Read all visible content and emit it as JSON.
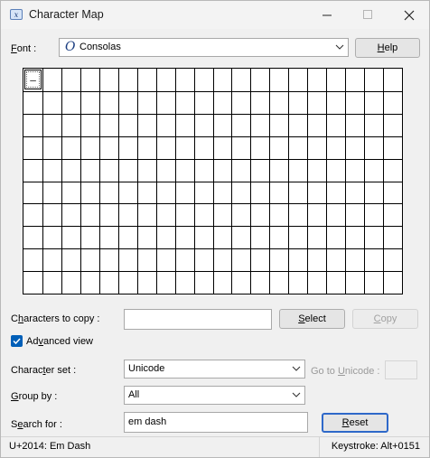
{
  "window": {
    "title": "Character Map",
    "controls": [
      "minimize",
      "maximize",
      "close"
    ]
  },
  "font": {
    "label": "Font :",
    "label_underline": "F",
    "value": "Consolas",
    "icon": "opentype-icon"
  },
  "help_button": {
    "label": "Help",
    "underline": "H"
  },
  "grid": {
    "columns": 20,
    "rows": 10,
    "selected_char": "—"
  },
  "copy": {
    "label": "Characters to copy :",
    "label_underline": "h",
    "value": "",
    "select_label": "Select",
    "select_underline": "S",
    "copy_label": "Copy",
    "copy_underline": "C"
  },
  "advanced_view": {
    "label": "Advanced view",
    "checked": true,
    "underline": "v"
  },
  "character_set": {
    "label": "Character set :",
    "underline": "t",
    "value": "Unicode",
    "goto_label": "Go to Unicode :",
    "goto_underline": "U"
  },
  "group_by": {
    "label": "Group by :",
    "underline": "G",
    "value": "All"
  },
  "search": {
    "label": "Search for :",
    "underline": "e",
    "value": "em dash",
    "reset_label": "Reset",
    "reset_underline": "R"
  },
  "status": {
    "left": "U+2014: Em Dash",
    "right": "Keystroke: Alt+0151"
  },
  "colors": {
    "accent": "#005fb8",
    "default_button_border": "#2e68c9"
  }
}
